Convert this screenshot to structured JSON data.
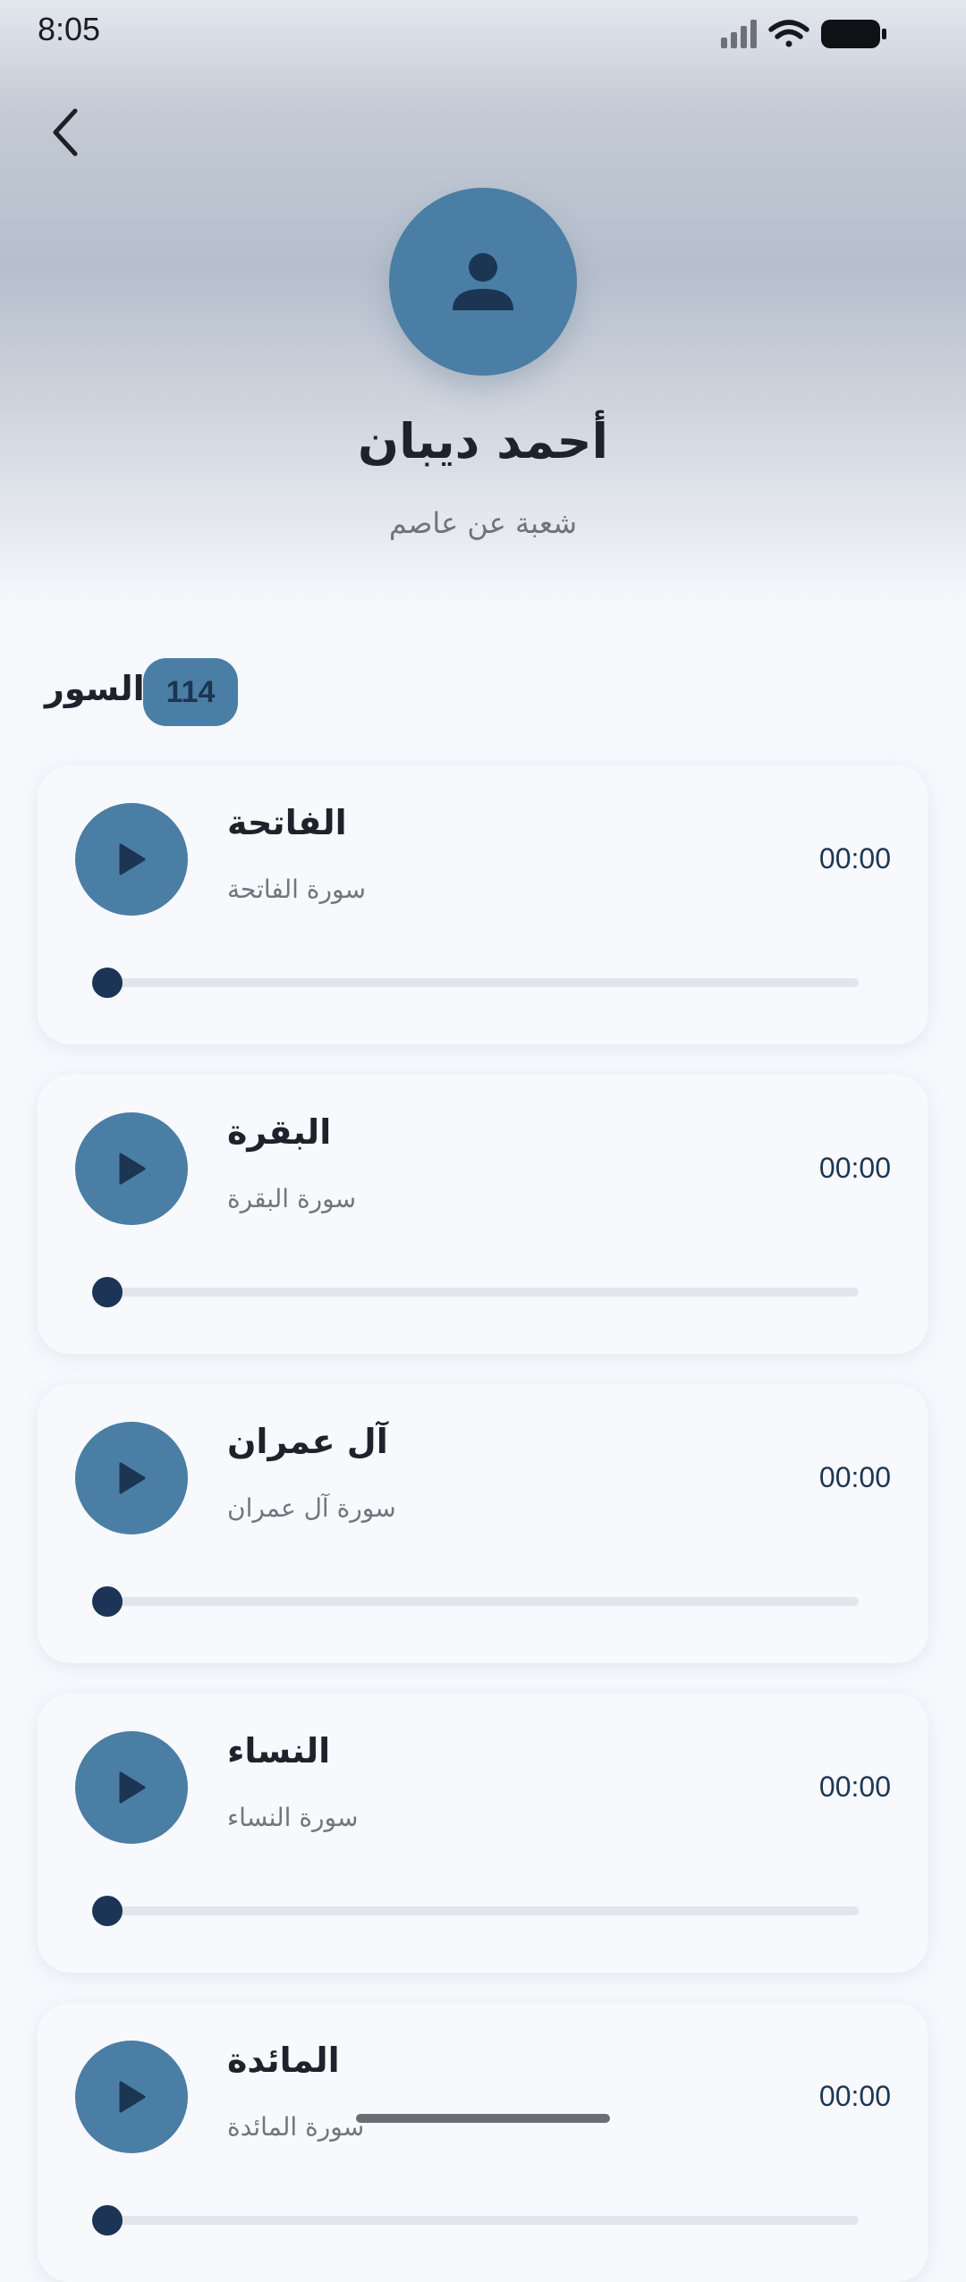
{
  "status_bar": {
    "time": "8:05"
  },
  "header": {
    "back_icon": "chevron-left-icon",
    "avatar_icon": "person-icon",
    "reciter_name": "أحمد ديبان",
    "reciter_subtitle": "شعبة عن عاصم"
  },
  "section": {
    "title": "السور",
    "count": "114"
  },
  "suras": [
    {
      "name": "الفاتحة",
      "subtitle": "سورة الفاتحة",
      "time": "00:00",
      "progress": 0
    },
    {
      "name": "البقرة",
      "subtitle": "سورة البقرة",
      "time": "00:00",
      "progress": 0
    },
    {
      "name": "آل عمران",
      "subtitle": "سورة آل عمران",
      "time": "00:00",
      "progress": 0
    },
    {
      "name": "النساء",
      "subtitle": "سورة النساء",
      "time": "00:00",
      "progress": 0
    },
    {
      "name": "المائدة",
      "subtitle": "سورة المائدة",
      "time": "00:00",
      "progress": 0
    }
  ],
  "colors": {
    "accent": "#4a7ea5",
    "dark_accent": "#1c3455",
    "background": "#f6f8fc"
  }
}
